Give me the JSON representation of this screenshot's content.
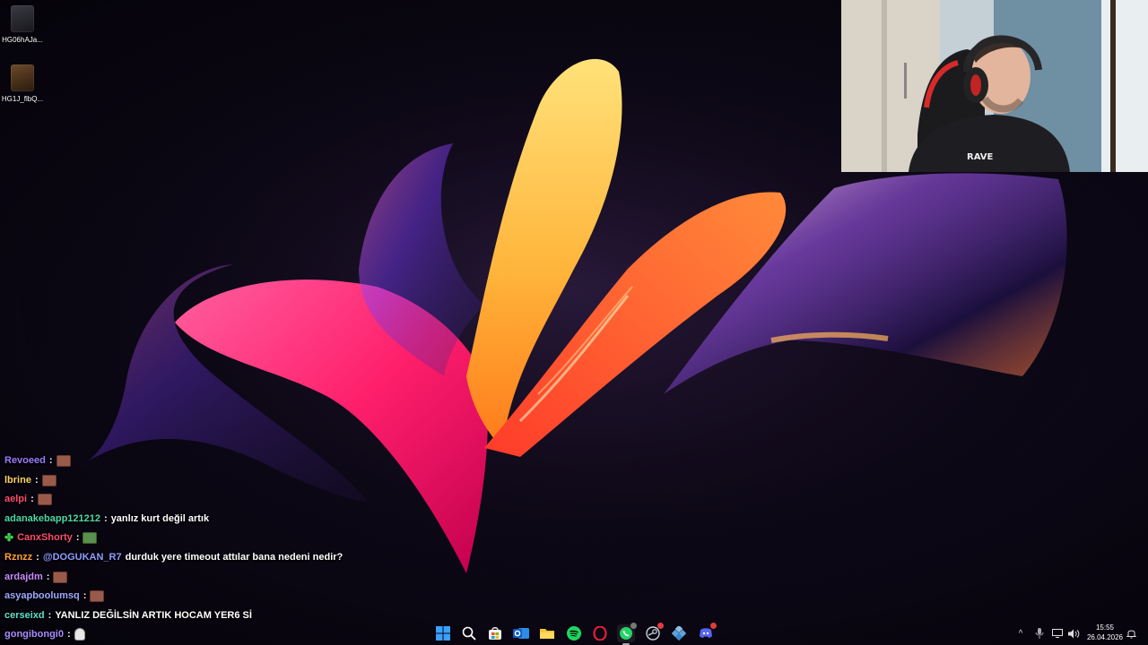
{
  "desktop": {
    "icons": [
      {
        "label": "HG06hAJa..."
      },
      {
        "label": "HG1J_flbQ..."
      }
    ]
  },
  "chat": {
    "lines": [
      {
        "user": "Revoeed",
        "user_color": "#9c7bff",
        "sep": ":",
        "message": "",
        "emote": "emote-face"
      },
      {
        "user": "lbrine",
        "user_color": "#ffd36a",
        "sep": ":",
        "message": "",
        "emote": "emote-face"
      },
      {
        "user": "aelpi",
        "user_color": "#ff4d6d",
        "sep": ":",
        "message": "",
        "emote": "emote-face"
      },
      {
        "user": "adanakebapp121212",
        "user_color": "#4fd9a6",
        "sep": ":",
        "message": "yanlız kurt değil artık",
        "emote": ""
      },
      {
        "user": "CanxShorty",
        "user_color": "#ff4d6d",
        "sep": ":",
        "message": "",
        "emote": "emote-green",
        "badge": "✤"
      },
      {
        "user": "Rznzz",
        "user_color": "#ff9f3a",
        "sep": ":",
        "mention": "@DOGUKAN_R7",
        "message": "durduk yere timeout attılar bana nedeni nedir?",
        "emote": ""
      },
      {
        "user": "ardajdm",
        "user_color": "#c78bff",
        "sep": ":",
        "message": "",
        "emote": "emote-face"
      },
      {
        "user": "asyapboolumsq",
        "user_color": "#9fa8ff",
        "sep": ":",
        "message": "",
        "emote": "emote-face"
      },
      {
        "user": "cerseixd",
        "user_color": "#5fe0c8",
        "sep": ":",
        "message": "YANLIZ DEĞİLSİN ARTIK HOCAM YER6 Sİ",
        "emote": ""
      },
      {
        "user": "gongibongi0",
        "user_color": "#a98bff",
        "sep": ":",
        "message": "",
        "emote": "emote-ghost"
      }
    ]
  },
  "taskbar": {
    "apps": [
      {
        "name": "start-button",
        "icon": "windows-logo-icon",
        "color": "#3aa0ff"
      },
      {
        "name": "search-button",
        "icon": "search-icon",
        "color": "#ffffff"
      },
      {
        "name": "store-app",
        "icon": "store-icon",
        "color": "#f0f0f0"
      },
      {
        "name": "outlook-app",
        "icon": "outlook-icon",
        "color": "#2f8ae8"
      },
      {
        "name": "file-explorer-app",
        "icon": "folder-icon",
        "color": "#f3c640"
      },
      {
        "name": "spotify-app",
        "icon": "spotify-icon",
        "color": "#1ed760"
      },
      {
        "name": "opera-app",
        "icon": "opera-icon",
        "color": "#e0203a"
      },
      {
        "name": "whatsapp-app",
        "icon": "whatsapp-icon",
        "color": "#25d366"
      },
      {
        "name": "steam-app",
        "icon": "steam-icon",
        "color": "#c7d5e0"
      },
      {
        "name": "settings-app",
        "icon": "settings-grid-icon",
        "color": "#8fbfe6"
      },
      {
        "name": "discord-app",
        "icon": "discord-icon",
        "color": "#5865f2"
      }
    ],
    "tray": {
      "chevron": "^",
      "date": "26.04.2026",
      "time": "15:55"
    }
  }
}
